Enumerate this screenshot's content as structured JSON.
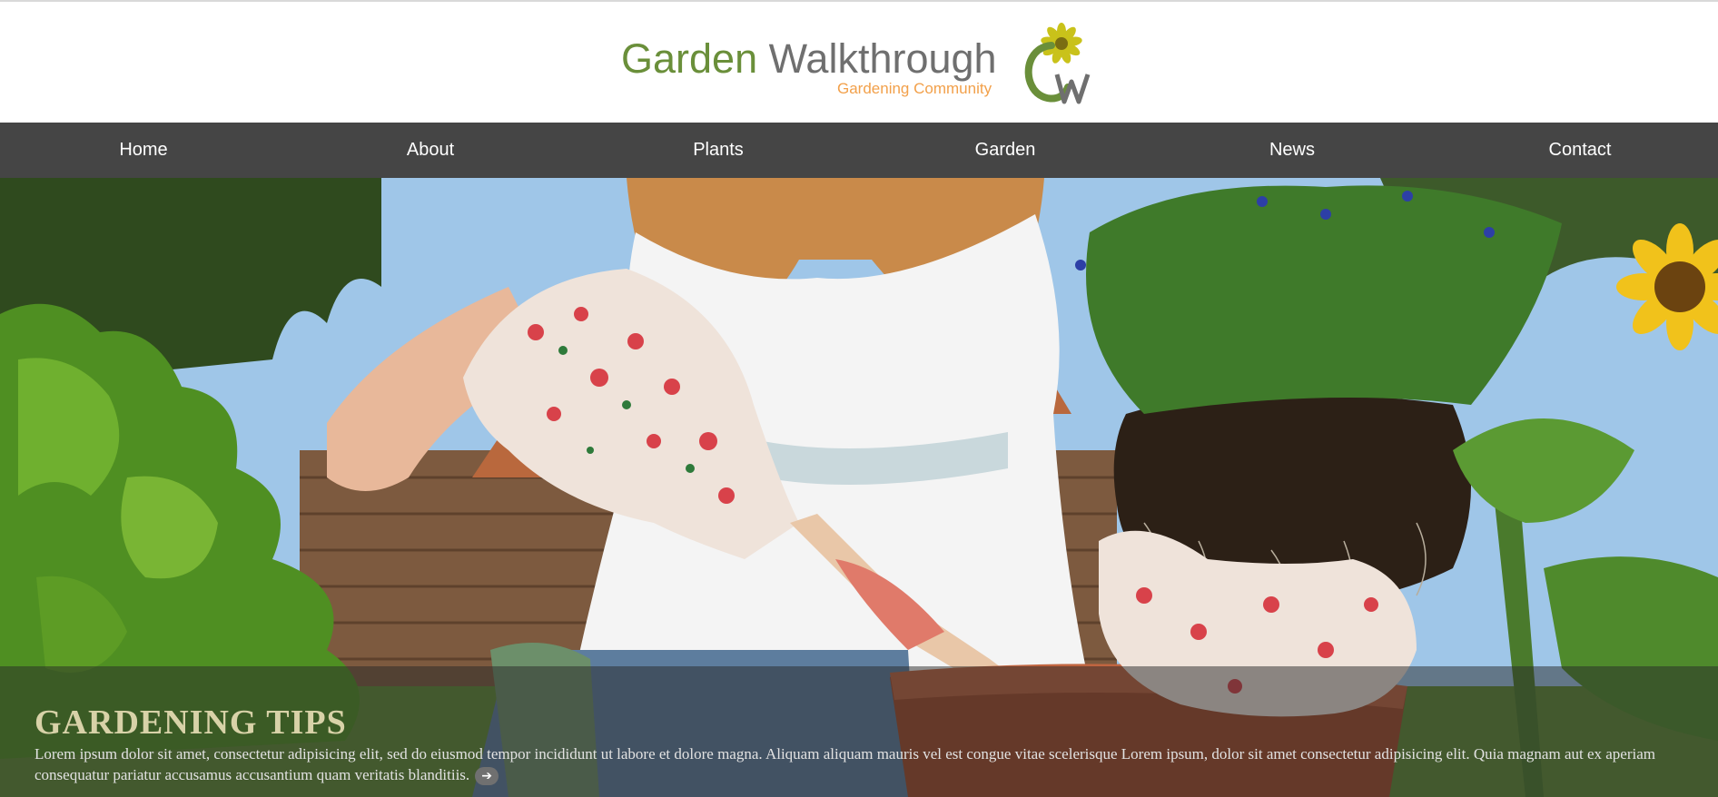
{
  "brand": {
    "title_part1": "Garden",
    "title_part2": "Walkthrough",
    "subtitle": "Gardening Community",
    "mark_letters": "GW",
    "colors": {
      "green": "#6a8f3a",
      "gray": "#6f6f6f",
      "orange": "#f2a04a",
      "flower": "#c9c21a"
    }
  },
  "nav": {
    "items": [
      {
        "label": "Home"
      },
      {
        "label": "About"
      },
      {
        "label": "Plants"
      },
      {
        "label": "Garden"
      },
      {
        "label": "News"
      },
      {
        "label": "Contact"
      }
    ],
    "background": "#454545"
  },
  "hero": {
    "title": "GARDENING TIPS",
    "text": "Lorem ipsum dolor sit amet, consectetur adipisicing elit, sed do eiusmod tempor incididunt ut labore et dolore magna. Aliquam aliquam mauris vel est congue vitae scelerisque Lorem ipsum, dolor sit amet consectetur adipisicing elit. Quia magnam aut ex aperiam consequatur pariatur accusamus accusantium quam veritatis blanditiis.",
    "more_icon": "arrow-right-icon"
  }
}
